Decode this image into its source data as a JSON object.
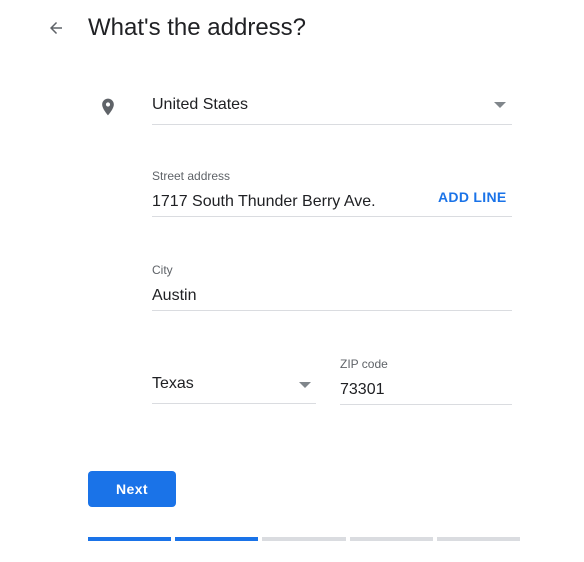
{
  "header": {
    "title": "What's the address?",
    "back_icon": "arrow-left-icon"
  },
  "form": {
    "country": {
      "value": "United States",
      "icon": "location-pin-icon"
    },
    "street": {
      "label": "Street address",
      "value": "1717 South Thunder Berry Ave.",
      "add_line_label": "ADD LINE"
    },
    "city": {
      "label": "City",
      "value": "Austin"
    },
    "state": {
      "value": "Texas"
    },
    "zip": {
      "label": "ZIP code",
      "value": "73301"
    }
  },
  "actions": {
    "next_label": "Next"
  },
  "progress": {
    "total_steps": 5,
    "completed_steps": 2
  },
  "colors": {
    "accent": "#1a73e8",
    "divider": "#dadce0",
    "text": "#202124",
    "label": "#5f6368",
    "icon": "#5f6368"
  }
}
